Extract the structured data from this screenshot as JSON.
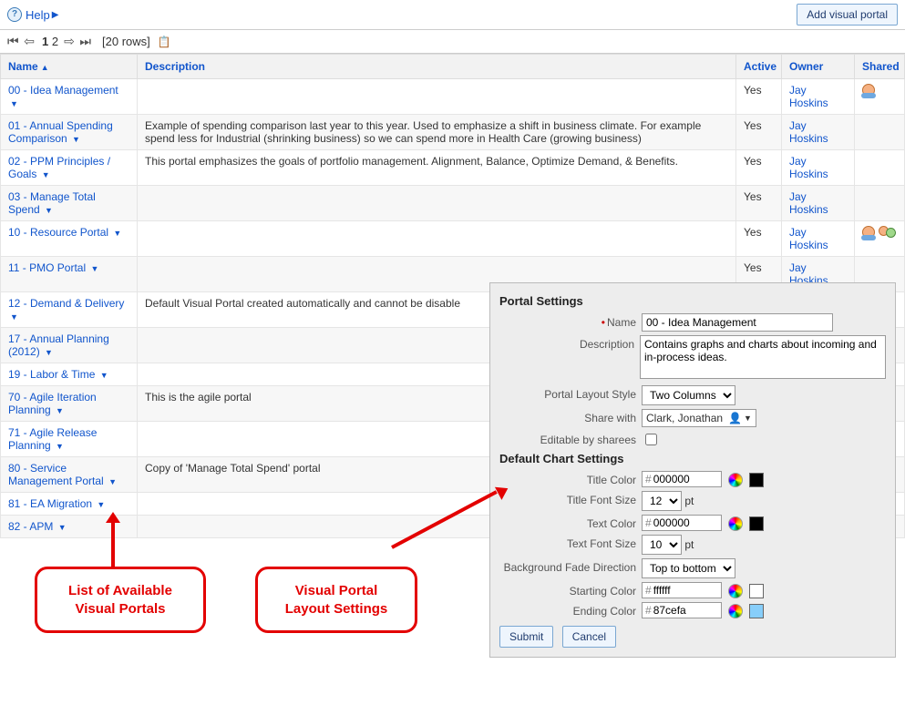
{
  "header": {
    "help_label": "Help",
    "add_button": "Add visual portal"
  },
  "nav": {
    "page_current": "1",
    "page_other": "2",
    "rowcount": "[20 rows]"
  },
  "columns": {
    "name": "Name",
    "description": "Description",
    "active": "Active",
    "owner": "Owner",
    "shared": "Shared"
  },
  "rows": [
    {
      "name": "00 - Idea Management",
      "desc": "",
      "active": "Yes",
      "owner": "Jay Hoskins",
      "shared": "single"
    },
    {
      "name": "01 - Annual Spending Comparison",
      "desc": "Example of spending comparison last year to this year. Used to emphasize a shift in business climate. For example spend less for Industrial (shrinking business) so we can spend more in Health Care (growing business)",
      "active": "Yes",
      "owner": "Jay Hoskins",
      "shared": ""
    },
    {
      "name": "02 - PPM Principles / Goals",
      "desc": "This portal emphasizes the goals of portfolio management. Alignment, Balance, Optimize Demand, & Benefits.",
      "active": "Yes",
      "owner": "Jay Hoskins",
      "shared": ""
    },
    {
      "name": "03 - Manage Total Spend",
      "desc": "",
      "active": "Yes",
      "owner": "Jay Hoskins",
      "shared": ""
    },
    {
      "name": "10 - Resource Portal",
      "desc": "",
      "active": "Yes",
      "owner": "Jay Hoskins",
      "shared": "group"
    },
    {
      "name": "11 - PMO Portal",
      "desc": "",
      "active": "Yes",
      "owner": "Jay Hoskins",
      "shared": ""
    },
    {
      "name": "12 - Demand & Delivery",
      "desc": "Default Visual Portal created automatically and cannot be disable",
      "active": "",
      "owner": "",
      "shared": ""
    },
    {
      "name": "17 - Annual Planning (2012)",
      "desc": "",
      "active": "",
      "owner": "",
      "shared": ""
    },
    {
      "name": "19 - Labor & Time",
      "desc": "",
      "active": "",
      "owner": "",
      "shared": ""
    },
    {
      "name": "70 - Agile Iteration Planning",
      "desc": "This is the agile portal",
      "active": "",
      "owner": "",
      "shared": ""
    },
    {
      "name": "71 - Agile Release Planning",
      "desc": "",
      "active": "",
      "owner": "",
      "shared": ""
    },
    {
      "name": "80 - Service Management Portal",
      "desc": "Copy of 'Manage Total Spend' portal",
      "active": "",
      "owner": "",
      "shared": ""
    },
    {
      "name": "81 - EA Migration",
      "desc": "",
      "active": "",
      "owner": "",
      "shared": ""
    },
    {
      "name": "82 - APM",
      "desc": "",
      "active": "",
      "owner": "",
      "shared": ""
    }
  ],
  "settings": {
    "header1": "Portal Settings",
    "name_label": "Name",
    "name_value": "00 - Idea Management",
    "desc_label": "Description",
    "desc_value": "Contains graphs and charts about incoming and in-process ideas.",
    "layout_label": "Portal Layout Style",
    "layout_value": "Two Columns",
    "share_label": "Share with",
    "share_value": "Clark, Jonathan",
    "editable_label": "Editable by sharees",
    "header2": "Default Chart Settings",
    "titlecolor_label": "Title Color",
    "titlecolor_value": "000000",
    "titlefont_label": "Title Font Size",
    "titlefont_value": "12",
    "textcolor_label": "Text Color",
    "textcolor_value": "000000",
    "textfont_label": "Text Font Size",
    "textfont_value": "10",
    "fade_label": "Background Fade Direction",
    "fade_value": "Top to bottom",
    "startcolor_label": "Starting Color",
    "startcolor_value": "ffffff",
    "endcolor_label": "Ending Color",
    "endcolor_value": "87cefa",
    "pt": "pt",
    "submit": "Submit",
    "cancel": "Cancel"
  },
  "callouts": {
    "left": "List of Available Visual Portals",
    "right": "Visual Portal Layout Settings"
  }
}
